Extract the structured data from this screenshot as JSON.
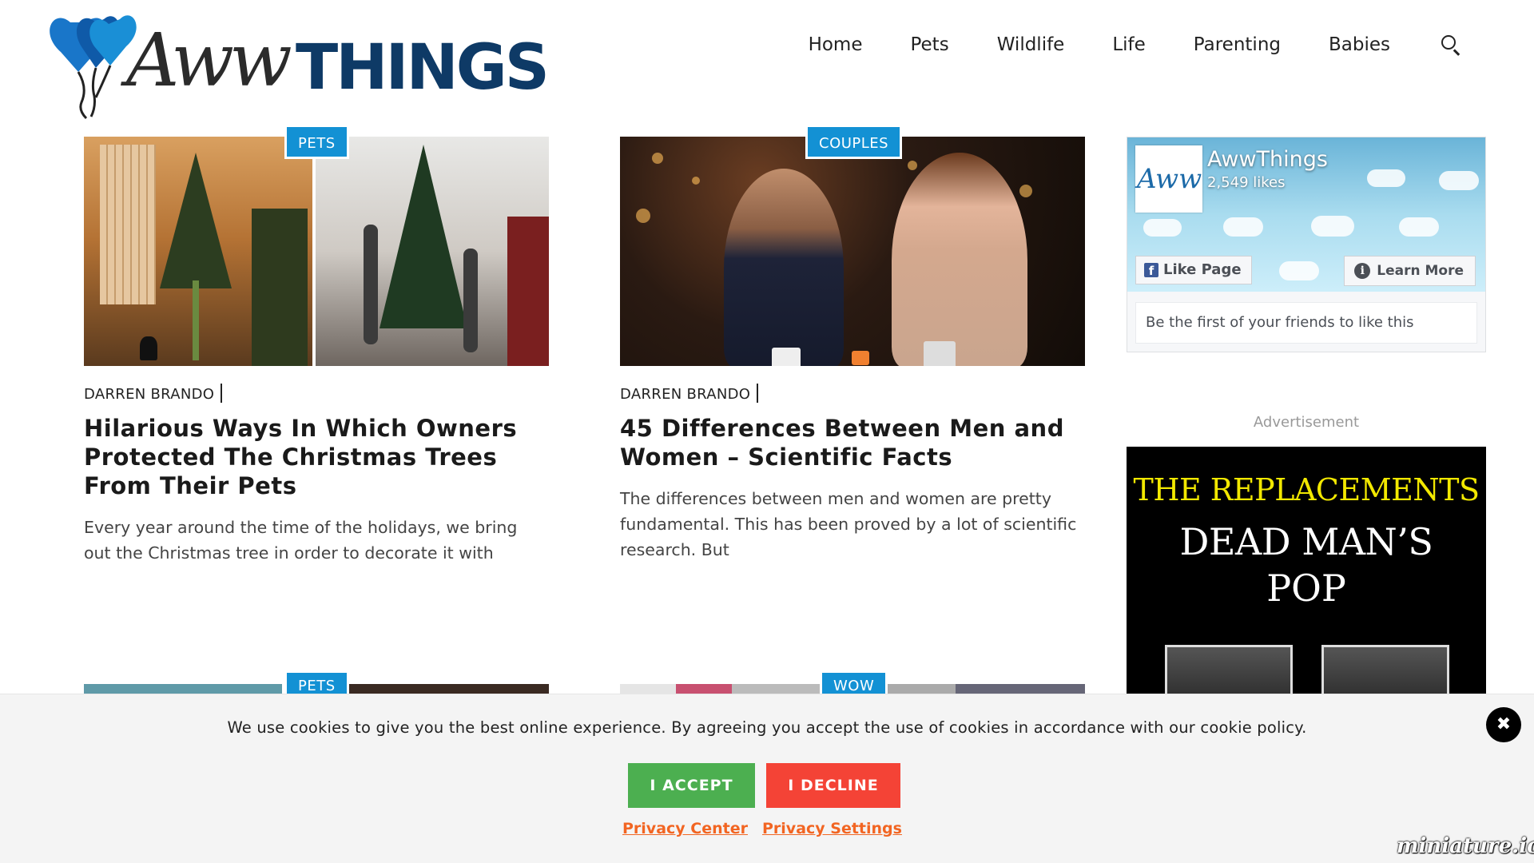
{
  "site": {
    "logo_aww": "Aww",
    "logo_things": "THINGS"
  },
  "nav": {
    "items": [
      "Home",
      "Pets",
      "Wildlife",
      "Life",
      "Parenting",
      "Babies"
    ],
    "search_icon": "search-icon"
  },
  "articles": [
    {
      "category": "PETS",
      "author": "DARREN BRANDO",
      "title": "Hilarious Ways In Which Owners Protected The Christmas Trees From Their Pets",
      "excerpt": "Every year around the time of the holidays, we bring out the Christmas tree in order to decorate it with"
    },
    {
      "category": "COUPLES",
      "author": "DARREN BRANDO",
      "title": "45 Differences Between Men and Women – Scientific Facts",
      "excerpt": "The differences between men and women are pretty fundamental. This has been proved by a lot of scientific research. But"
    }
  ],
  "next_row": {
    "badge_left": "PETS",
    "badge_right": "WOW"
  },
  "facebook": {
    "avatar_text": "Aww",
    "page_name": "AwwThings",
    "likes": "2,549 likes",
    "like_button": "Like Page",
    "learn_button": "Learn More",
    "friends_text": "Be the first of your friends to like this"
  },
  "ad": {
    "label": "Advertisement",
    "line1": "THE REPLACEMENTS",
    "line2": "DEAD MAN’S",
    "line3": "POP"
  },
  "cookie": {
    "text": "We use cookies to give you the best online experience. By agreeing you accept the use of cookies in accordance with our cookie policy.",
    "accept": "I ACCEPT",
    "decline": "I DECLINE",
    "privacy_center": "Privacy Center",
    "privacy_settings": "Privacy Settings",
    "close_glyph": "✖"
  },
  "watermark": "miniature.io",
  "colors": {
    "brand_blue": "#0e3a66",
    "badge_blue": "#1391d4",
    "accept_green": "#4caf50",
    "decline_red": "#f44336",
    "link_orange": "#f26522"
  }
}
